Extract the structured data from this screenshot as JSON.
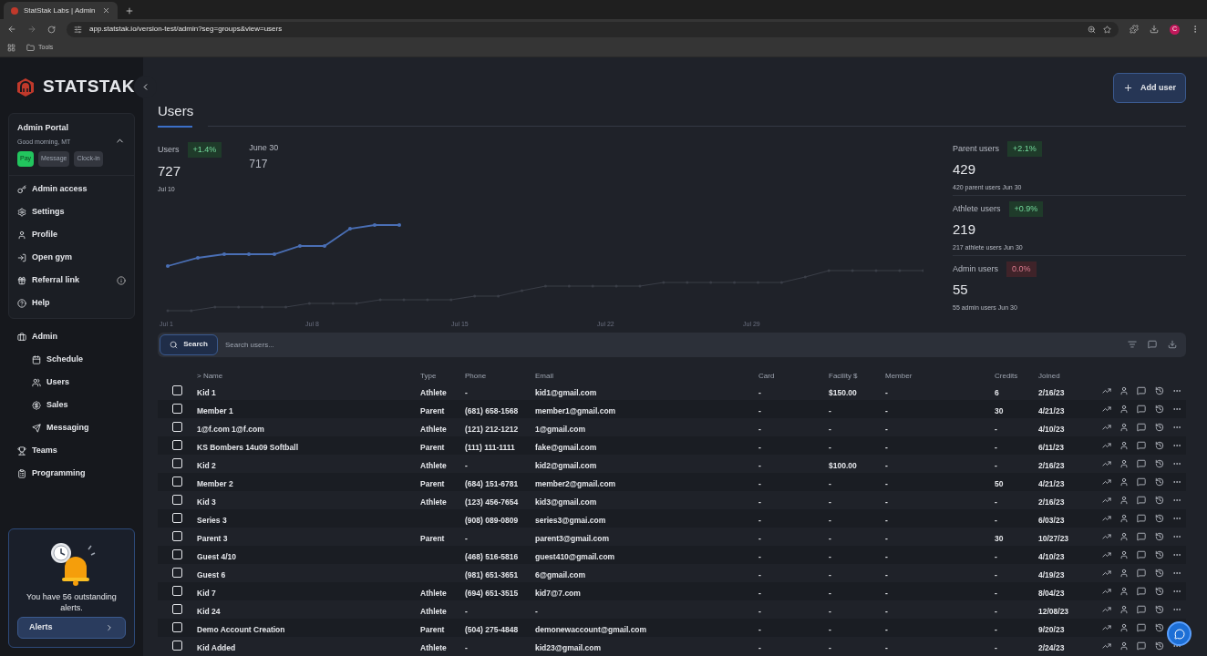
{
  "browser": {
    "tab_title": "StatStak Labs | Admin",
    "url": "app.statstak.io/version-test/admin?seg=groups&view=users",
    "bookmarks": [
      "Tools"
    ],
    "profile_initial": "C"
  },
  "sidebar": {
    "logo": "STATSTAK",
    "portal": {
      "title": "Admin Portal",
      "greeting": "Good morning, MT",
      "expanded": true,
      "actions": [
        {
          "label": "Pay",
          "kind": "primary"
        },
        {
          "label": "Message",
          "kind": "secondary"
        },
        {
          "label": "Clock-in",
          "kind": "secondary"
        }
      ],
      "items": [
        {
          "label": "Admin access",
          "info": false
        },
        {
          "label": "Settings",
          "info": false
        },
        {
          "label": "Profile",
          "info": false
        },
        {
          "label": "Open gym",
          "info": false
        },
        {
          "label": "Referral link",
          "info": true
        },
        {
          "label": "Help",
          "info": false
        }
      ]
    },
    "nav": [
      {
        "label": "Admin",
        "children": [
          {
            "label": "Schedule"
          },
          {
            "label": "Users"
          },
          {
            "label": "Sales"
          },
          {
            "label": "Messaging"
          }
        ]
      },
      {
        "label": "Teams"
      },
      {
        "label": "Programming"
      }
    ],
    "alert": {
      "message": "You have 56 outstanding alerts.",
      "button": "Alerts"
    }
  },
  "main": {
    "add_button": "Add user",
    "title": "Users",
    "headline": {
      "label": "Users",
      "change": "+1.4%",
      "color": "#1f3b2a",
      "value": "727",
      "date": "Jul 10",
      "compare_label": "June 30",
      "compare_value": "717"
    },
    "chart": {
      "axis_labels": [
        "Jul 1",
        "Jul 8",
        "Jul 15",
        "Jul 22",
        "Jul 29"
      ]
    },
    "breakdown": [
      {
        "label": "Parent users",
        "change": "+2.1%",
        "color": "#1f3b2a",
        "value": "429",
        "note": "420 parent users Jun 30"
      },
      {
        "label": "Athlete users",
        "change": "+0.9%",
        "color": "#1f3b2a",
        "value": "219",
        "note": "217 athlete users Jun 30"
      },
      {
        "label": "Admin users",
        "change": "0.0%",
        "color": "#3f2329",
        "value": "55",
        "note": "55 admin users Jun 30"
      }
    ],
    "search": {
      "button": "Search",
      "placeholder": "Search users..."
    },
    "table": {
      "columns": [
        "> Name",
        "Type",
        "Phone",
        "Email",
        "Card",
        "Facility $",
        "Member",
        "Credits",
        "Joined"
      ],
      "rows": [
        {
          "checked": false,
          "cells": [
            "Kid 1",
            "Athlete",
            "-",
            "kid1@gmail.com",
            "-",
            "$150.00",
            "-",
            "6",
            "2/16/23"
          ]
        },
        {
          "checked": false,
          "cells": [
            "Member 1",
            "Parent",
            "(681) 658-1568",
            "member1@gmail.com",
            "-",
            "-",
            "-",
            "30",
            "4/21/23"
          ]
        },
        {
          "checked": false,
          "cells": [
            "1@f.com 1@f.com",
            "Athlete",
            "(121) 212-1212",
            "1@gmail.com",
            "-",
            "-",
            "-",
            "-",
            "4/10/23"
          ]
        },
        {
          "checked": false,
          "cells": [
            "KS Bombers 14u09 Softball",
            "Parent",
            "(111) 111-1111",
            "fake@gmail.com",
            "-",
            "-",
            "-",
            "-",
            "6/11/23"
          ]
        },
        {
          "checked": false,
          "cells": [
            "Kid 2",
            "Athlete",
            "-",
            "kid2@gmail.com",
            "-",
            "$100.00",
            "-",
            "-",
            "2/16/23"
          ]
        },
        {
          "checked": false,
          "cells": [
            "Member 2",
            "Parent",
            "(684) 151-6781",
            "member2@gmail.com",
            "-",
            "-",
            "-",
            "50",
            "4/21/23"
          ]
        },
        {
          "checked": false,
          "cells": [
            "Kid 3",
            "Athlete",
            "(123) 456-7654",
            "kid3@gmail.com",
            "-",
            "-",
            "-",
            "-",
            "2/16/23"
          ]
        },
        {
          "checked": false,
          "cells": [
            "Series 3",
            "",
            "(908) 089-0809",
            "series3@gmai.com",
            "-",
            "-",
            "-",
            "-",
            "6/03/23"
          ]
        },
        {
          "checked": false,
          "cells": [
            "Parent 3",
            "Parent",
            "-",
            "parent3@gmail.com",
            "-",
            "-",
            "-",
            "30",
            "10/27/23"
          ]
        },
        {
          "checked": false,
          "cells": [
            "Guest 4/10",
            "",
            "(468) 516-5816",
            "guest410@gmail.com",
            "-",
            "-",
            "-",
            "-",
            "4/10/23"
          ]
        },
        {
          "checked": false,
          "cells": [
            "Guest 6",
            "",
            "(981) 651-3651",
            "6@gmail.com",
            "-",
            "-",
            "-",
            "-",
            "4/19/23"
          ]
        },
        {
          "checked": false,
          "cells": [
            "Kid 7",
            "Athlete",
            "(694) 651-3515",
            "kid7@7.com",
            "-",
            "-",
            "-",
            "-",
            "8/04/23"
          ]
        },
        {
          "checked": false,
          "cells": [
            "Kid 24",
            "Athlete",
            "-",
            "-",
            "-",
            "-",
            "-",
            "-",
            "12/08/23"
          ]
        },
        {
          "checked": false,
          "cells": [
            "Demo Account Creation",
            "Parent",
            "(504) 275-4848",
            "demonewaccount@gmail.com",
            "-",
            "-",
            "-",
            "-",
            "9/20/23"
          ]
        },
        {
          "checked": false,
          "cells": [
            "Kid Added",
            "Athlete",
            "-",
            "kid23@gmail.com",
            "-",
            "-",
            "-",
            "-",
            "2/24/23"
          ]
        }
      ]
    }
  }
}
